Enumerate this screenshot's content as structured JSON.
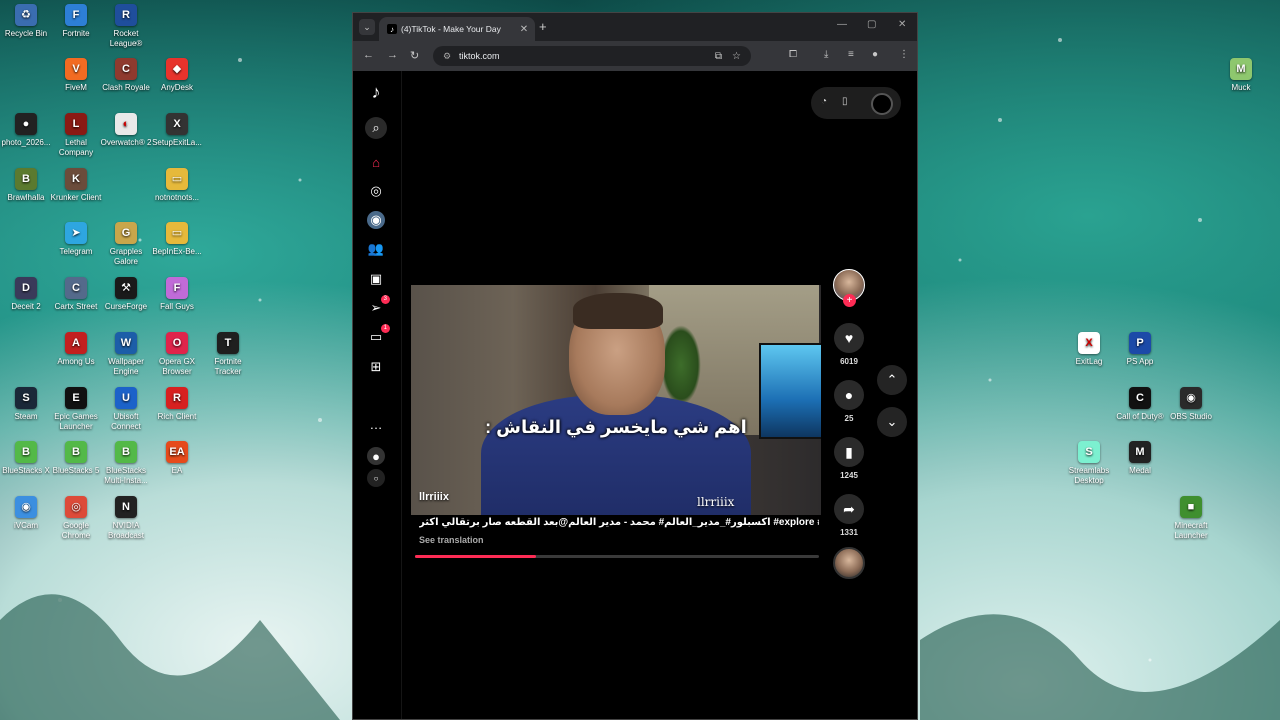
{
  "desktop": {
    "icons_left": [
      {
        "name": "Recycle Bin",
        "color": "#3a6db0",
        "glyph": "♻"
      },
      {
        "name": "Fortnite",
        "color": "#2d7fd6",
        "glyph": "F"
      },
      {
        "name": "Rocket League®",
        "color": "#1f4e9c",
        "glyph": "R"
      },
      {
        "name": "FiveM",
        "color": "#f26b22",
        "glyph": "V"
      },
      {
        "name": "Clash Royale",
        "color": "#8f3a2e",
        "glyph": "C"
      },
      {
        "name": "AnyDesk",
        "color": "#e7332c",
        "glyph": "◆"
      },
      {
        "name": "photo_2026...",
        "color": "#222222",
        "glyph": "●"
      },
      {
        "name": "Lethal Company",
        "color": "#8a1a14",
        "glyph": "L"
      },
      {
        "name": "Overwatch® 2",
        "color": "#e9e9e9",
        "glyph": "◐"
      },
      {
        "name": "SetupExitLa...",
        "color": "#333333",
        "glyph": "X"
      },
      {
        "name": "Brawlhalla",
        "color": "#5b7a2f",
        "glyph": "B"
      },
      {
        "name": "Krunker Client",
        "color": "#6b4c3b",
        "glyph": "K"
      },
      {
        "name": "notnotnots...",
        "color": "#e6b93b",
        "glyph": "▭"
      },
      {
        "name": "Telegram",
        "color": "#2ea6e0",
        "glyph": "➤"
      },
      {
        "name": "Grapples Galore",
        "color": "#c9a64b",
        "glyph": "G"
      },
      {
        "name": "BepInEx-Be...",
        "color": "#e6b93b",
        "glyph": "▭"
      },
      {
        "name": "Deceit 2",
        "color": "#3a3a5a",
        "glyph": "D"
      },
      {
        "name": "Cartx Street",
        "color": "#546a8b",
        "glyph": "C"
      },
      {
        "name": "CurseForge",
        "color": "#1a1a1a",
        "glyph": "⚒"
      },
      {
        "name": "Fall Guys",
        "color": "#c06bd8",
        "glyph": "F"
      },
      {
        "name": "Among Us",
        "color": "#c21f1f",
        "glyph": "A"
      },
      {
        "name": "Wallpaper Engine",
        "color": "#1c5ea8",
        "glyph": "W"
      },
      {
        "name": "Opera GX Browser",
        "color": "#e0244b",
        "glyph": "O"
      },
      {
        "name": "Fortnite Tracker",
        "color": "#1f1f1f",
        "glyph": "T"
      },
      {
        "name": "Steam",
        "color": "#1b2838",
        "glyph": "S"
      },
      {
        "name": "Epic Games Launcher",
        "color": "#111111",
        "glyph": "E"
      },
      {
        "name": "Ubisoft Connect",
        "color": "#1c62c9",
        "glyph": "U"
      },
      {
        "name": "Rich Client",
        "color": "#d72020",
        "glyph": "R"
      },
      {
        "name": "BlueStacks X",
        "color": "#53b948",
        "glyph": "B"
      },
      {
        "name": "BlueStacks 5",
        "color": "#53b948",
        "glyph": "B"
      },
      {
        "name": "BlueStacks Multi-Insta...",
        "color": "#53b948",
        "glyph": "B"
      },
      {
        "name": "EA",
        "color": "#e64a1b",
        "glyph": "EA"
      },
      {
        "name": "iVCam",
        "color": "#3c8fe0",
        "glyph": "◉"
      },
      {
        "name": "Google Chrome",
        "color": "#dd4b39",
        "glyph": "◎"
      },
      {
        "name": "NVIDIA Broadcast",
        "color": "#222222",
        "glyph": "N"
      }
    ],
    "icons_right": [
      {
        "name": "Muck",
        "color": "#8ec76e",
        "glyph": "M"
      },
      {
        "name": "ExitLag",
        "color": "#ffffff",
        "glyph": "X"
      },
      {
        "name": "PS App",
        "color": "#1c4aa8",
        "glyph": "P"
      },
      {
        "name": "Call of Duty®",
        "color": "#111111",
        "glyph": "C"
      },
      {
        "name": "OBS Studio",
        "color": "#2a2a2a",
        "glyph": "◉"
      },
      {
        "name": "Streamlabs Desktop",
        "color": "#7cf0d0",
        "glyph": "S"
      },
      {
        "name": "Medal",
        "color": "#222222",
        "glyph": "M"
      },
      {
        "name": "Minecraft Launcher",
        "color": "#3f8f2f",
        "glyph": "■"
      }
    ]
  },
  "browser": {
    "tab_title": "(4)TikTok - Make Your Day",
    "url": "tiktok.com"
  },
  "tiktok": {
    "nav_badges": {
      "inbox": "3",
      "messages": "1"
    },
    "video": {
      "caption_overlay": "اهم شي مايخسر في النقاش :",
      "watermark_left": "llrriiix",
      "watermark_right": "llrriiix",
      "description": "اكسبلور#_مدير_العالم# محمد - مدير العالم@بعد القطعه صار برتقالي اكثر #explore #foryou #fyp",
      "see_translation": "See translation",
      "progress_fraction": 0.3
    },
    "actions": {
      "likes": "6019",
      "comments": "25",
      "saves": "1245",
      "shares": "1331"
    }
  }
}
